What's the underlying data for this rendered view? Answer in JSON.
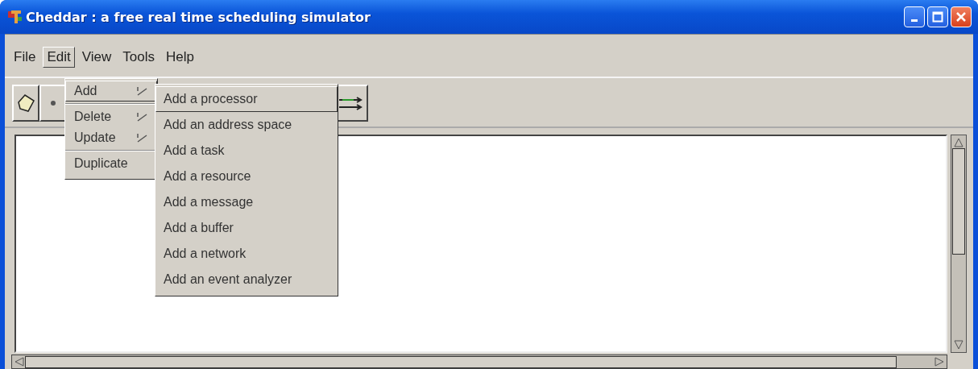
{
  "window": {
    "title": "Cheddar : a free real time scheduling simulator"
  },
  "menu_bar": [
    {
      "label": "File",
      "selected": false
    },
    {
      "label": "Edit",
      "selected": true
    },
    {
      "label": "View",
      "selected": false
    },
    {
      "label": "Tools",
      "selected": false
    },
    {
      "label": "Help",
      "selected": false
    }
  ],
  "edit_menu": [
    {
      "label": "Add",
      "selected": true,
      "has_submenu": true,
      "separator_after": true
    },
    {
      "label": "Delete",
      "selected": false,
      "has_submenu": true,
      "separator_after": false
    },
    {
      "label": "Update",
      "selected": false,
      "has_submenu": true,
      "separator_after": true
    },
    {
      "label": "Duplicate",
      "selected": false,
      "has_submenu": false,
      "separator_after": false
    }
  ],
  "add_submenu": [
    {
      "label": "Add a processor",
      "selected": true
    },
    {
      "label": "Add an address space",
      "selected": false
    },
    {
      "label": "Add a task",
      "selected": false
    },
    {
      "label": "Add a resource",
      "selected": false
    },
    {
      "label": "Add a message",
      "selected": false
    },
    {
      "label": "Add a buffer",
      "selected": false
    },
    {
      "label": "Add a network",
      "selected": false
    },
    {
      "label": "Add an event analyzer",
      "selected": false
    }
  ]
}
